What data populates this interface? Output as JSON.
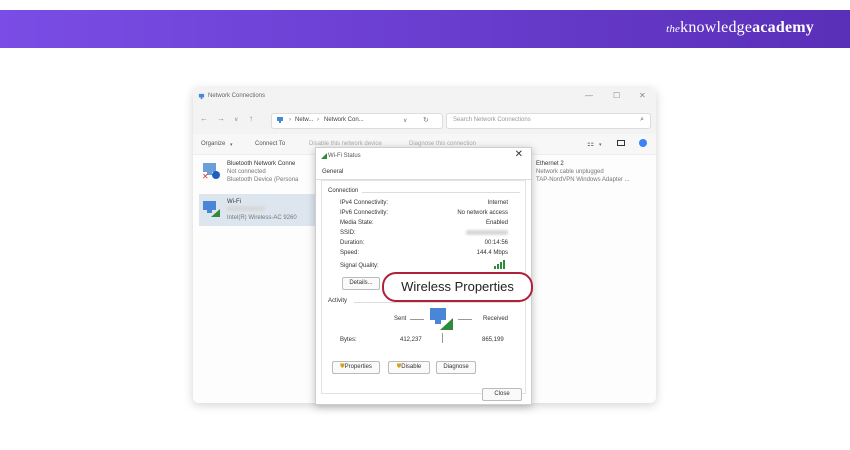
{
  "banner": {
    "brand_prefix": "the",
    "brand_main": "knowledge",
    "brand_bold": "academy"
  },
  "window": {
    "title": "Network Connections",
    "controls": [
      "—",
      "☐",
      "✕"
    ],
    "path": [
      "Netw...",
      "Network Con..."
    ],
    "search_placeholder": "Search Network Connections",
    "commands": [
      "Organize",
      "Connect To",
      "Disable this network device",
      "Diagnose this connection"
    ],
    "items": [
      {
        "name": "Bluetooth Network Conne",
        "status": "Not connected",
        "device": "Bluetooth Device (Persona"
      },
      {
        "name": "Wi-Fi",
        "status": "",
        "device": "Intel(R) Wireless-AC 9260"
      },
      {
        "name": "Ethernet 2",
        "status": "Network cable unplugged",
        "device": "TAP-NordVPN Windows Adapter ..."
      }
    ]
  },
  "dialog": {
    "title": "Wi-Fi Status",
    "tab": "General",
    "connection_header": "Connection",
    "connection": [
      {
        "label": "IPv4 Connectivity:",
        "value": "Internet"
      },
      {
        "label": "IPv6 Connectivity:",
        "value": "No network access"
      },
      {
        "label": "Media State:",
        "value": "Enabled"
      },
      {
        "label": "SSID:",
        "value": ""
      },
      {
        "label": "Duration:",
        "value": "00:14:56"
      },
      {
        "label": "Speed:",
        "value": "144.4 Mbps"
      }
    ],
    "signal_label": "Signal Quality:",
    "details_button": "Details...",
    "activity_header": "Activity",
    "sent_label": "Sent",
    "received_label": "Received",
    "bytes_label": "Bytes:",
    "bytes_sent": "412,237",
    "bytes_received": "865,199",
    "properties_button": "Properties",
    "disable_button": "Disable",
    "diagnose_button": "Diagnose",
    "close_button": "Close"
  },
  "callout": {
    "text": "Wireless Properties",
    "border_color": "#b0203a"
  }
}
